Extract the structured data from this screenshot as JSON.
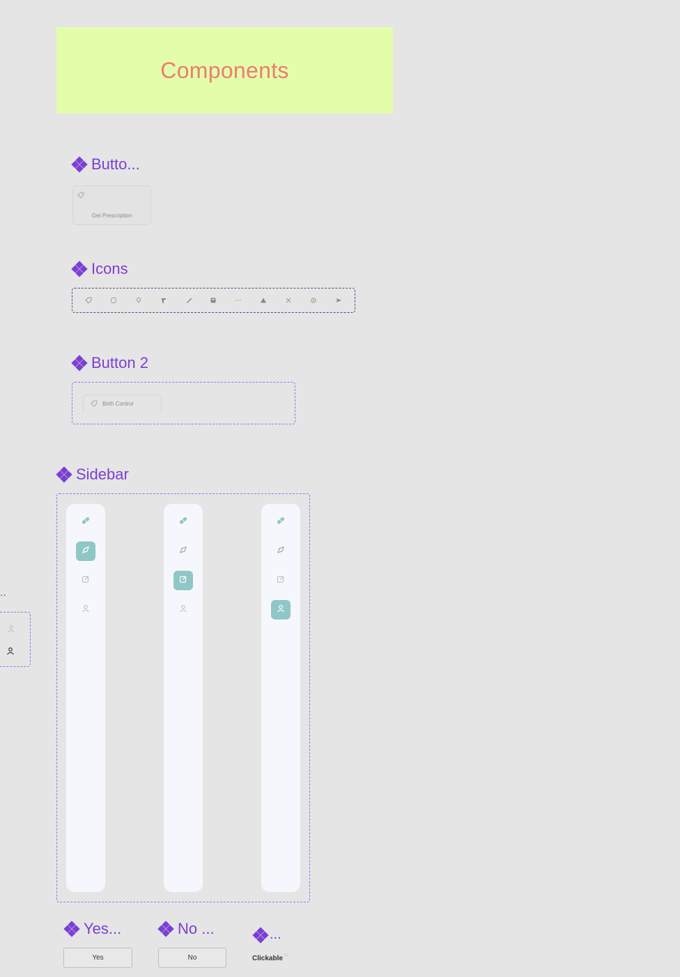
{
  "header": {
    "title": "Components"
  },
  "sections": {
    "button": {
      "title": "Butto..."
    },
    "icons": {
      "title": "Icons"
    },
    "button2": {
      "title": "Button 2"
    },
    "sidebar": {
      "title": "Sidebar"
    },
    "yes": {
      "title": "Yes..."
    },
    "no": {
      "title": "No ..."
    },
    "clickable": {
      "title": "..."
    }
  },
  "button_card": {
    "label": "Get Prescription",
    "icon": "tag-icon"
  },
  "icons_row": [
    "tag-icon",
    "chat-bubble-icon",
    "lightbulb-icon",
    "hand-icon",
    "syringe-icon",
    "calculator-icon",
    "ellipsis-icon",
    "triangle-icon",
    "close-icon",
    "gear-icon",
    "send-icon"
  ],
  "button2": {
    "label": "Birth Control",
    "icon": "tag-icon"
  },
  "sidebar_variants": [
    {
      "active": "compass"
    },
    {
      "active": "edit"
    },
    {
      "active": "profile"
    }
  ],
  "sidebar_items": [
    "pill",
    "compass",
    "edit",
    "profile"
  ],
  "side_fragment": {
    "dots": "..",
    "icons": [
      "profile-icon",
      "profile-icon"
    ]
  },
  "yes_button": {
    "label": "Yes"
  },
  "no_button": {
    "label": "No"
  },
  "clickable": {
    "label": "Clickable"
  },
  "colors": {
    "accent_purple": "#7b3fd4",
    "banner_bg": "#e4fdab",
    "banner_text": "#e8806e",
    "active_teal": "#8fc7c6",
    "pill_teal": "#8fc7c6"
  }
}
